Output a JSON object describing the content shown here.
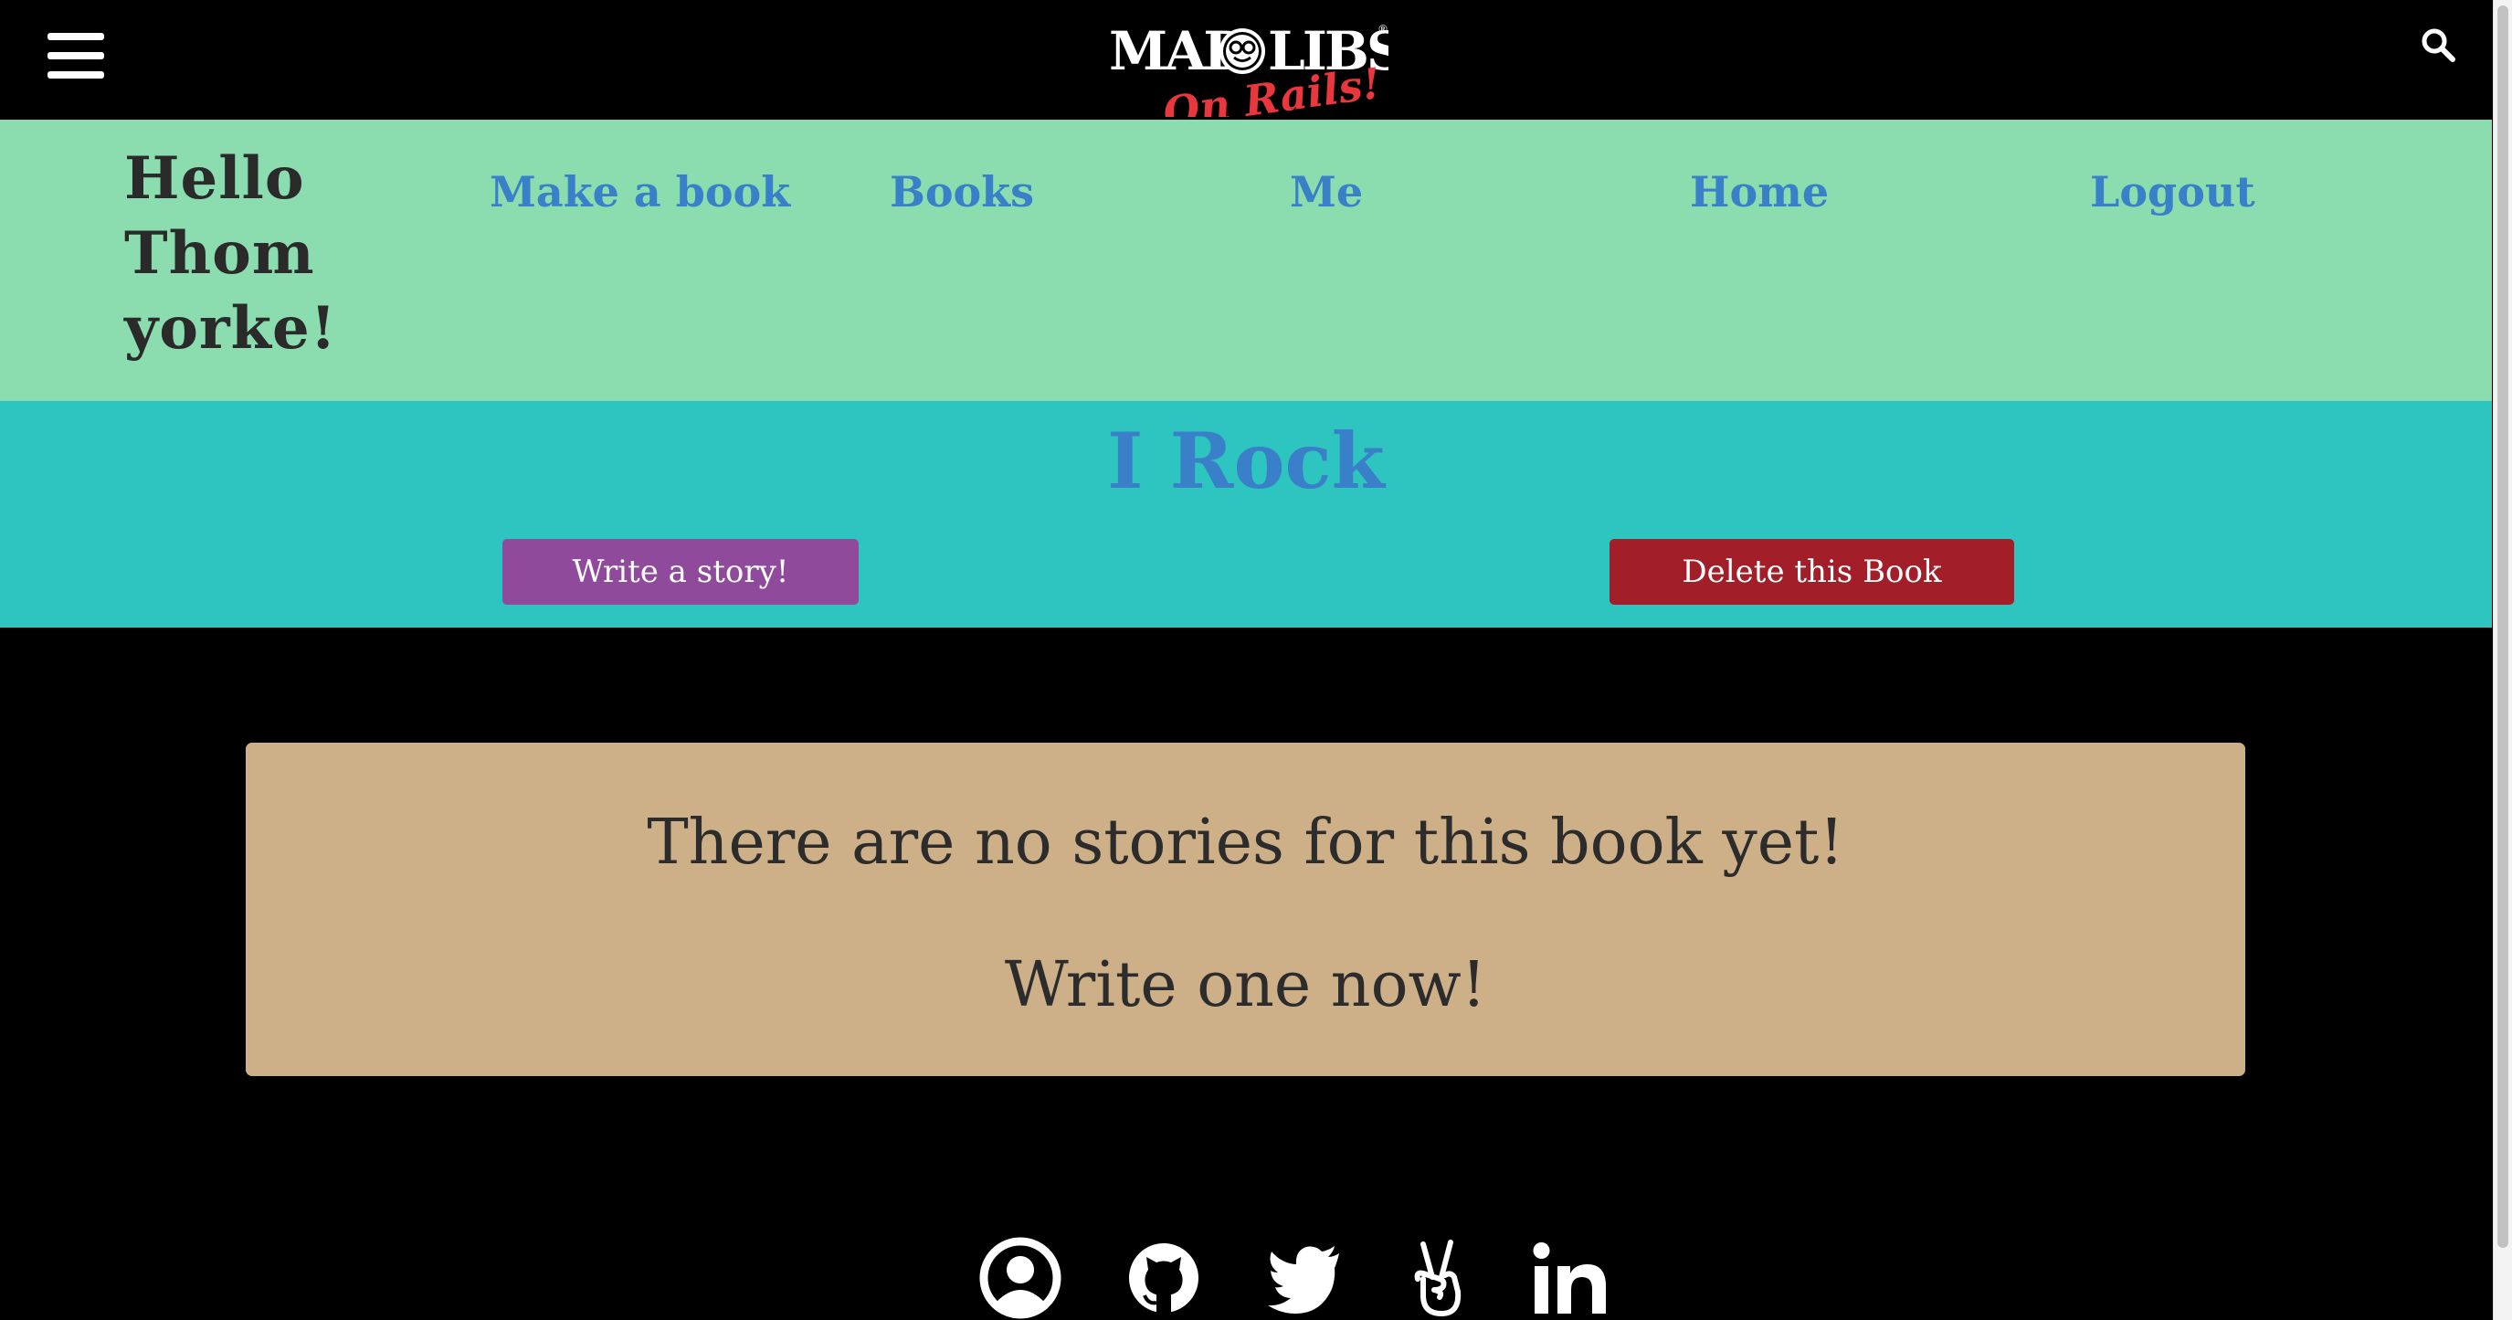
{
  "header": {
    "logo_text_main": "MAD LIBS",
    "logo_text_sub": "On Rails!",
    "menu_icon": "hamburger-menu-icon",
    "search_icon": "search-icon"
  },
  "nav": {
    "greeting_lines": [
      "Hello",
      "Thom",
      "yorke!"
    ],
    "links": [
      "Make a book",
      "Books",
      "Me",
      "Home",
      "Logout"
    ]
  },
  "book": {
    "title": "I Rock",
    "write_button": "Write a story!",
    "delete_button": "Delete this Book"
  },
  "empty_state": {
    "line1": "There are no stories for this book yet!",
    "line2": "Write one now!"
  },
  "footer": {
    "icons": [
      "user-circle-icon",
      "github-icon",
      "twitter-icon",
      "angellist-icon",
      "linkedin-icon"
    ]
  },
  "colors": {
    "nav_band": "#8bdcaf",
    "teal_band": "#2ec5c1",
    "link_blue": "#3a80c8",
    "write_button": "#8f4a9c",
    "delete_button": "#a21e29",
    "card": "#cdb087",
    "logo_red": "#e8373d"
  }
}
